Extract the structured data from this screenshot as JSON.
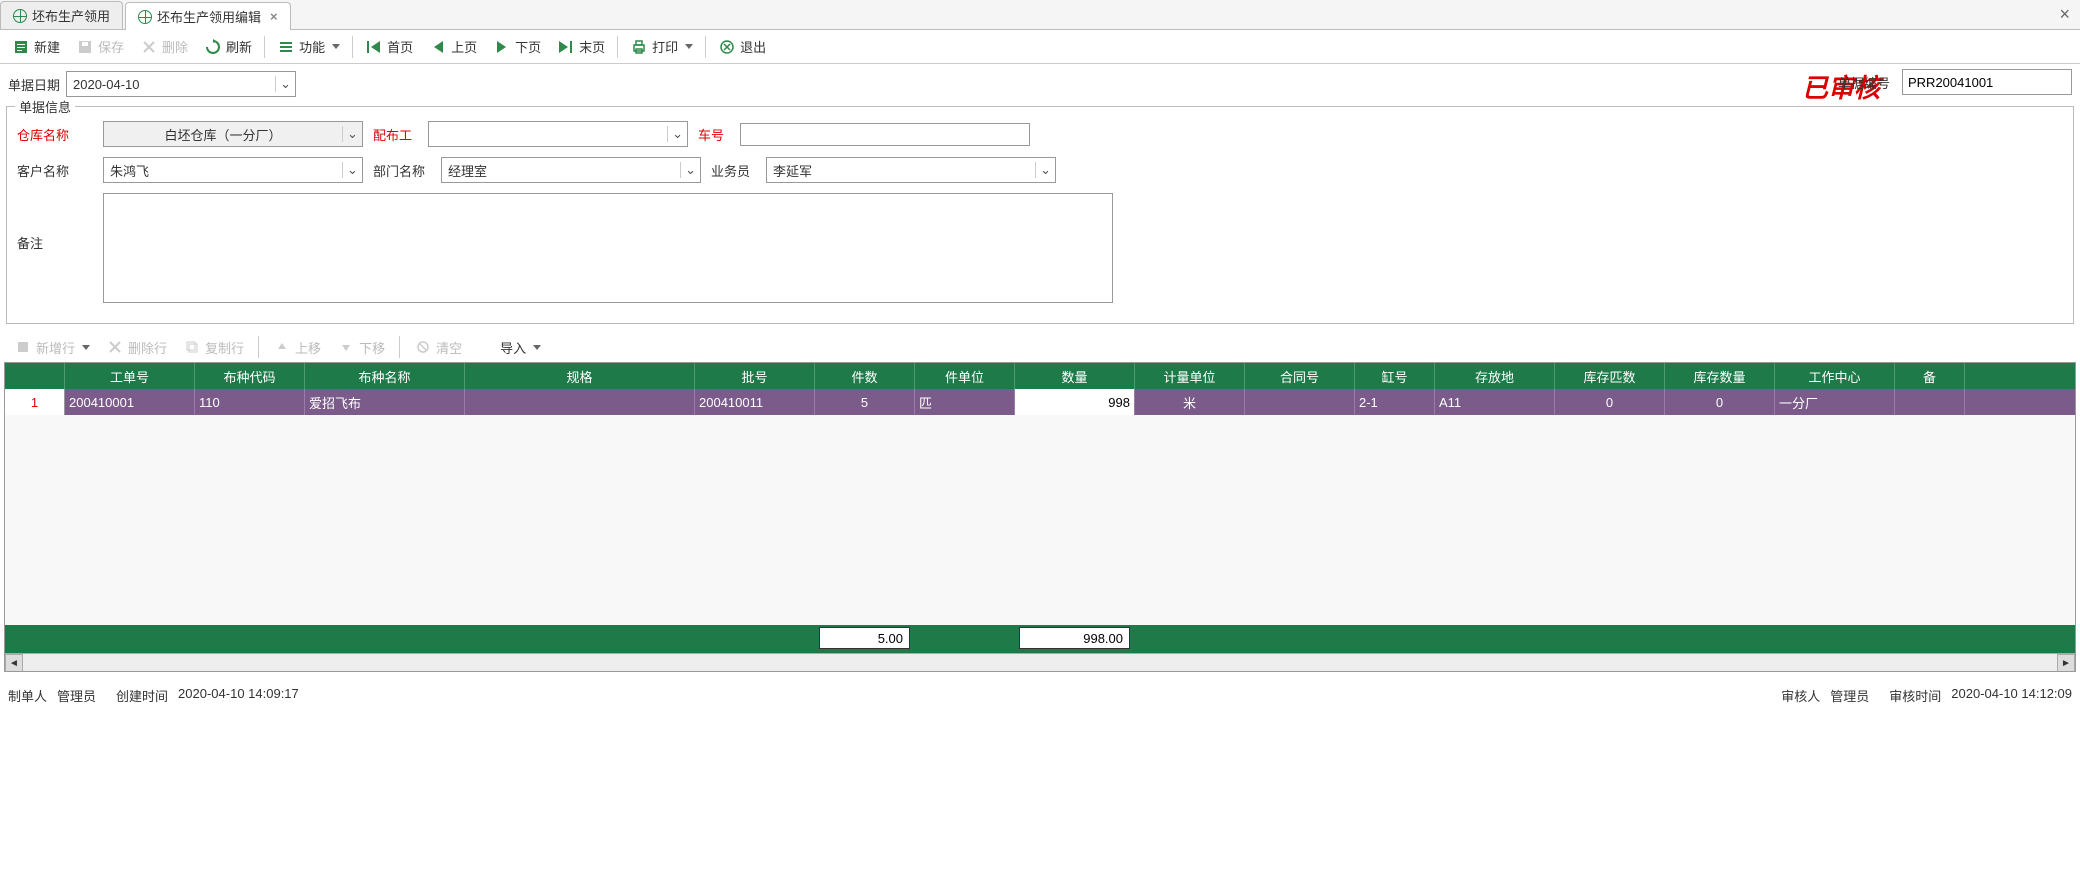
{
  "tabs": [
    {
      "label": "坯布生产领用",
      "active": false
    },
    {
      "label": "坯布生产领用编辑",
      "active": true
    }
  ],
  "toolbar": {
    "new": "新建",
    "save": "保存",
    "delete": "删除",
    "refresh": "刷新",
    "func": "功能",
    "first": "首页",
    "prev": "上页",
    "next": "下页",
    "last": "末页",
    "print": "打印",
    "exit": "退出"
  },
  "doc": {
    "date_label": "单据日期",
    "date_value": "2020-04-10",
    "approved_stamp": "已审核",
    "no_label": "单据编号",
    "no_value": "PRR20041001"
  },
  "fieldset": {
    "title": "单据信息",
    "warehouse_label": "仓库名称",
    "warehouse_value": "白坯仓库（一分厂）",
    "worker_label": "配布工",
    "worker_value": "",
    "car_label": "车号",
    "car_value": "",
    "customer_label": "客户名称",
    "customer_value": "朱鸿飞",
    "dept_label": "部门名称",
    "dept_value": "经理室",
    "sales_label": "业务员",
    "sales_value": "李延军",
    "remarks_label": "备注",
    "remarks_value": ""
  },
  "line_toolbar": {
    "add": "新增行",
    "del": "删除行",
    "copy": "复制行",
    "up": "上移",
    "down": "下移",
    "clear": "清空",
    "import": "导入"
  },
  "columns": [
    "",
    "工单号",
    "布种代码",
    "布种名称",
    "规格",
    "批号",
    "件数",
    "件单位",
    "数量",
    "计量单位",
    "合同号",
    "缸号",
    "存放地",
    "库存匹数",
    "库存数量",
    "工作中心",
    "备"
  ],
  "rows": [
    {
      "num": "1",
      "workorder": "200410001",
      "code": "110",
      "name": "爱招飞布",
      "spec": "",
      "batch": "200410011",
      "pcs": "5",
      "pcs_unit": "匹",
      "qty": "998",
      "unit": "米",
      "contract": "",
      "vat": "2-1",
      "location": "A11",
      "stock_pcs": "0",
      "stock_qty": "0",
      "workcenter": "一分厂",
      "rem": ""
    }
  ],
  "sums": {
    "pcs": "5.00",
    "qty": "998.00"
  },
  "status": {
    "maker_label": "制单人",
    "maker": "管理员",
    "created_label": "创建时间",
    "created": "2020-04-10 14:09:17",
    "approver_label": "审核人",
    "approver": "管理员",
    "approved_time_label": "审核时间",
    "approved_time": "2020-04-10 14:12:09"
  }
}
